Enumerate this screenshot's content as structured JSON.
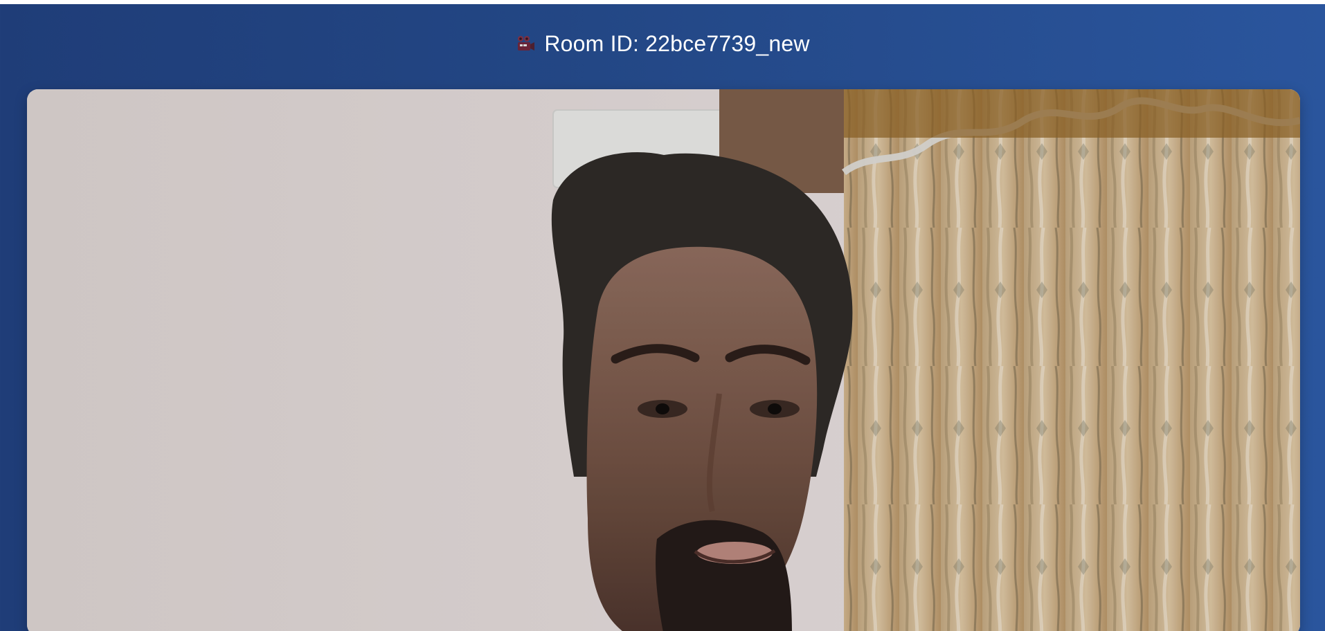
{
  "header": {
    "icon": "video-camera-icon",
    "title": "Room ID: 22bce7739_new"
  },
  "video": {
    "content": "local-webcam-feed"
  },
  "colors": {
    "background_start": "#1f3d78",
    "background_end": "#2a559d",
    "title_text": "#ffffff"
  }
}
